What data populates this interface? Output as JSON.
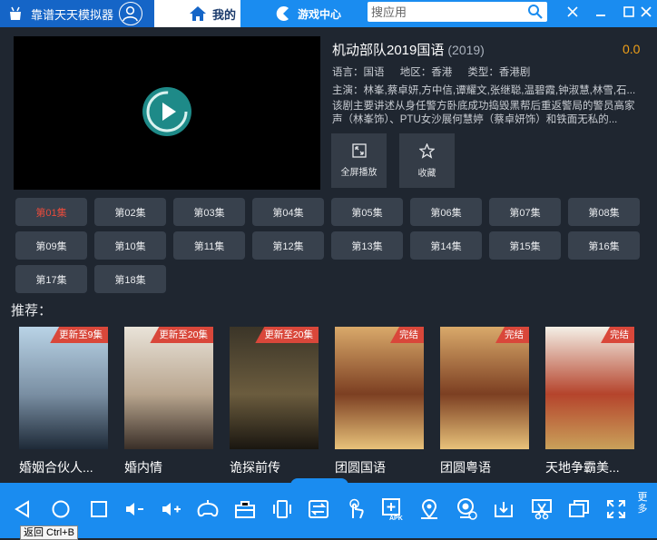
{
  "titlebar": {
    "app_title": "靠谱天天模拟器",
    "tab_mine": "我的",
    "tab_game": "游戏中心",
    "search_placeholder": "搜应用"
  },
  "movie": {
    "title": "机动部队2019国语",
    "year": "(2019)",
    "score": "0.0",
    "language": "语言：国语",
    "region": "地区：香港",
    "type": "类型：香港剧",
    "actors": "主演：林峯,蔡卓妍,方中信,谭耀文,张继聪,温碧霞,钟淑慧,林雪,石...",
    "description": "该剧主要讲述从身任警方卧底成功捣毁黑帮后重返警局的警员高家声（林峯饰）、PTU女沙展何慧婷（蔡卓妍饰）和铁面无私的..."
  },
  "actions": {
    "fullscreen": "全屏播放",
    "favorite": "收藏"
  },
  "episodes": [
    "第01集",
    "第02集",
    "第03集",
    "第04集",
    "第05集",
    "第06集",
    "第07集",
    "第08集",
    "第09集",
    "第10集",
    "第11集",
    "第12集",
    "第13集",
    "第14集",
    "第15集",
    "第16集",
    "第17集",
    "第18集"
  ],
  "active_episode": 0,
  "recommend": {
    "label": "推荐：",
    "items": [
      {
        "name": "婚姻合伙人...",
        "badge": "更新至9集",
        "colors": [
          "#b9d3e6",
          "#7a8fa3",
          "#1e2a38"
        ]
      },
      {
        "name": "婚内情",
        "badge": "更新至20集",
        "colors": [
          "#e9e3d9",
          "#b8a58e",
          "#3a2f28"
        ]
      },
      {
        "name": "诡探前传",
        "badge": "更新至20集",
        "colors": [
          "#3b3528",
          "#6b5c3e",
          "#1a1610"
        ]
      },
      {
        "name": "团圆国语",
        "badge": "完结",
        "colors": [
          "#d9a96a",
          "#7c3f22",
          "#e8c27a"
        ]
      },
      {
        "name": "团圆粤语",
        "badge": "完结",
        "colors": [
          "#d9a96a",
          "#7c3f22",
          "#e8c27a"
        ]
      },
      {
        "name": "天地争霸美...",
        "badge": "完结",
        "colors": [
          "#f4efe6",
          "#b5442c",
          "#c9a15a"
        ]
      }
    ]
  },
  "bottom": {
    "more": "更多",
    "tooltip": "返回 Ctrl+B"
  },
  "colors": {
    "accent": "#1a8cf0",
    "score": "#f0a018",
    "badge": "#d9473a",
    "active_episode": "#e84b3c"
  }
}
